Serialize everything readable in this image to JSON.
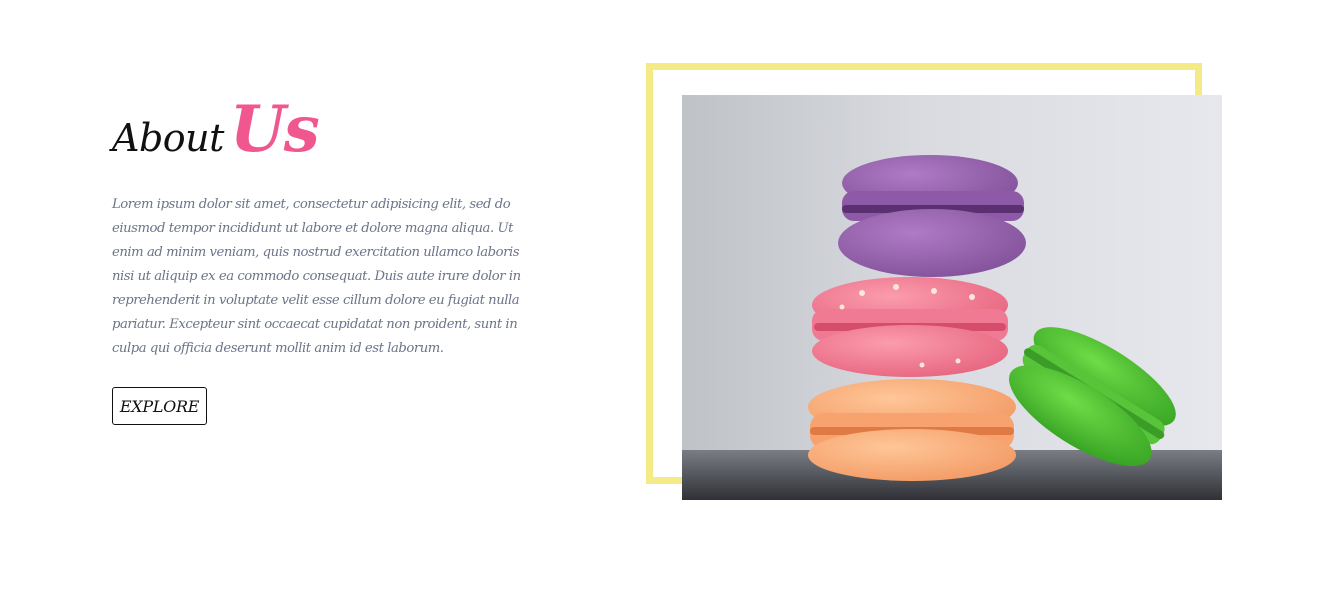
{
  "about": {
    "title_part1": "About",
    "title_part2": "Us",
    "body": "Lorem ipsum dolor sit amet, consectetur adipisicing elit, sed do eiusmod tempor incididunt ut labore et dolore magna aliqua. Ut enim ad minim veniam, quis nostrud exercitation ullamco laboris nisi ut aliquip ex ea commodo consequat. Duis aute irure dolor in reprehenderit in voluptate velit esse cillum dolore eu fugiat nulla pariatur. Excepteur sint occaecat cupidatat non proident, sunt in culpa qui officia deserunt mollit anim id est laborum.",
    "explore_label": "EXPLORE"
  },
  "image": {
    "subject": "stack of macarons",
    "alt": "Macarons"
  },
  "colors": {
    "accent_pink": "#f0578e",
    "frame_yellow": "#f4ea86",
    "body_text": "#6b7488",
    "heading_text": "#111111"
  }
}
